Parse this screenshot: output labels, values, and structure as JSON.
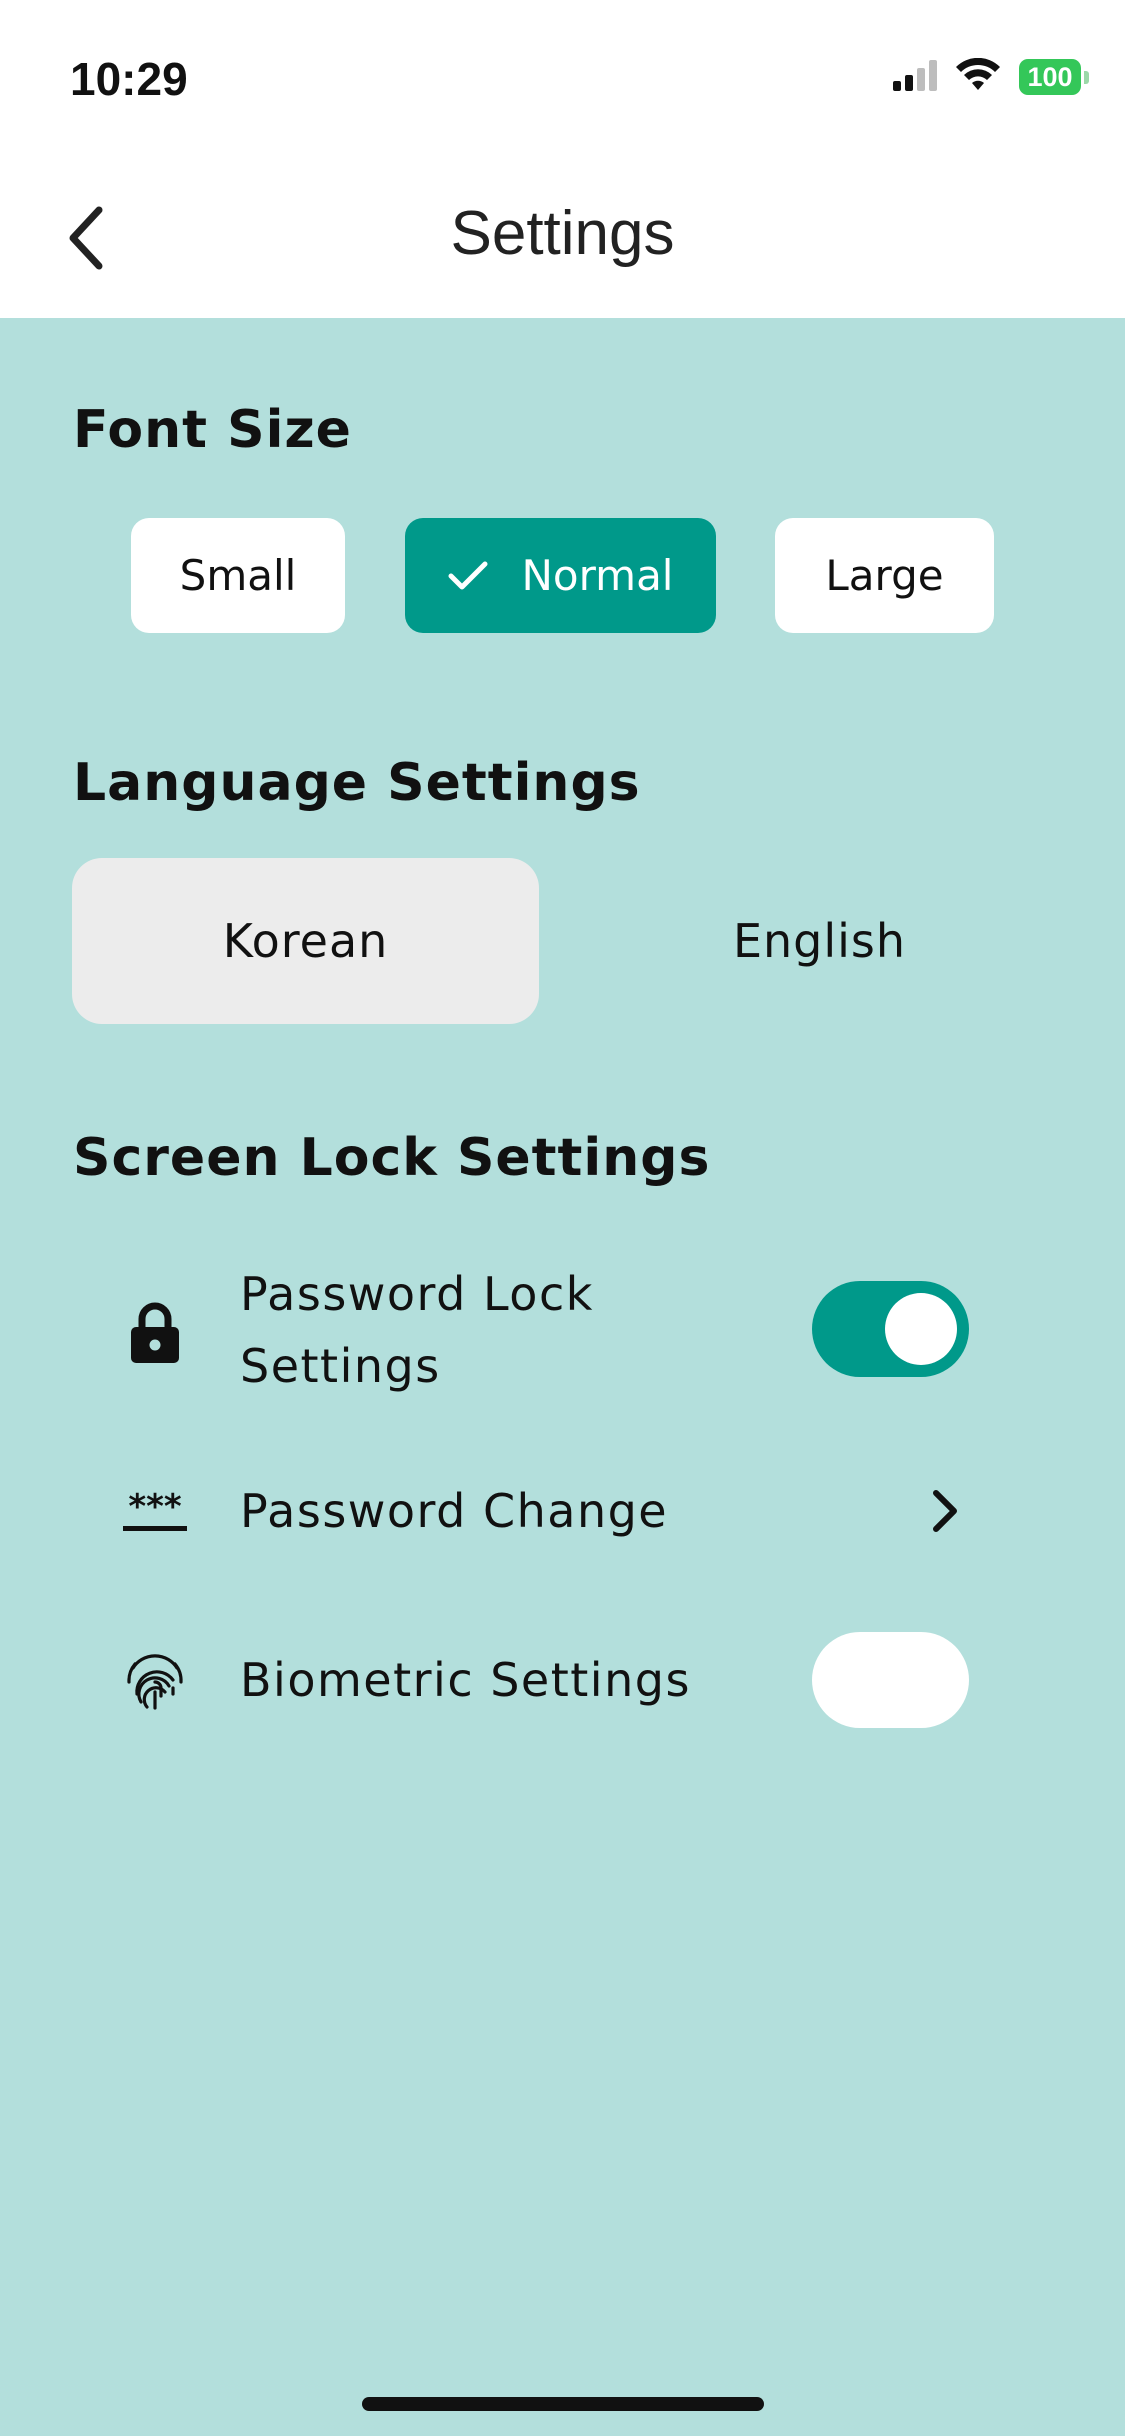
{
  "status_bar": {
    "time": "10:29",
    "battery_level": "100",
    "signal_bars_active": 2,
    "signal_bars_total": 4,
    "wifi_icon": "wifi-icon",
    "battery_color": "#34c759"
  },
  "header": {
    "title": "Settings",
    "back_icon": "chevron-left-icon"
  },
  "font_size": {
    "section_title": "Font Size",
    "options": [
      {
        "label": "Small",
        "selected": false
      },
      {
        "label": "Normal",
        "selected": true
      },
      {
        "label": "Large",
        "selected": false
      }
    ],
    "accent_color": "#00998a"
  },
  "language": {
    "section_title": "Language Settings",
    "options": [
      {
        "label": "Korean",
        "selected": true
      },
      {
        "label": "English",
        "selected": false
      }
    ]
  },
  "screen_lock": {
    "section_title": "Screen Lock Settings",
    "items": [
      {
        "label_line1": "Password Lock",
        "label_line2": "Settings",
        "icon": "lock-icon",
        "control": "toggle",
        "enabled": true
      },
      {
        "label": "Password Change",
        "icon": "password-asterisk-icon",
        "control": "chevron-right-icon"
      },
      {
        "label": "Biometric Settings",
        "icon": "fingerprint-icon",
        "control": "toggle",
        "enabled": false
      }
    ]
  },
  "colors": {
    "background": "#b3dfdc",
    "accent": "#00998a",
    "surface": "#ffffff",
    "selected_language_bg": "#ececec"
  }
}
